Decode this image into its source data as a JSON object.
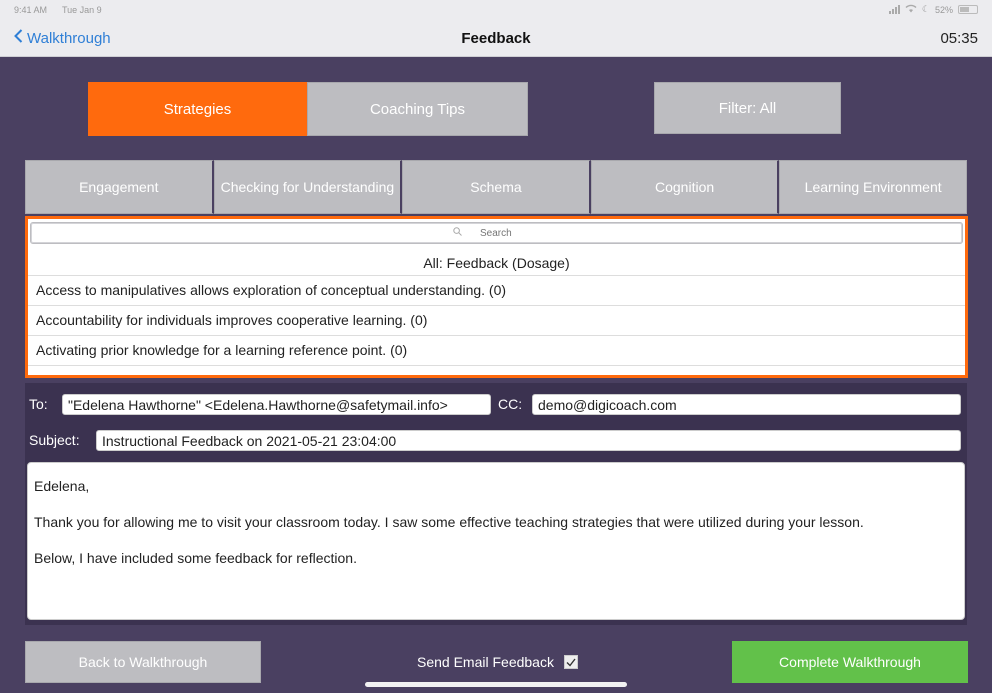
{
  "status_bar": {
    "time": "9:41 AM",
    "date": "Tue Jan 9",
    "battery": "52%"
  },
  "nav": {
    "back_label": "Walkthrough",
    "title": "Feedback",
    "timer": "05:35"
  },
  "tabs": [
    {
      "label": "Strategies",
      "selected": true
    },
    {
      "label": "Coaching Tips",
      "selected": false
    }
  ],
  "filter": {
    "label": "Filter: All"
  },
  "categories": [
    "Engagement",
    "Checking for Understanding",
    "Schema",
    "Cognition",
    "Learning Environment"
  ],
  "list": {
    "search_placeholder": "Search",
    "header": "All: Feedback (Dosage)",
    "items": [
      "Access to manipulatives allows exploration of conceptual understanding. (0)",
      "Accountability for individuals improves cooperative learning. (0)",
      "Activating prior knowledge for a learning reference point. (0)"
    ]
  },
  "email": {
    "to_label": "To:",
    "to_value": "\"Edelena Hawthorne\" <Edelena.Hawthorne@safetymail.info>",
    "cc_label": "CC:",
    "cc_value": "demo@digicoach.com",
    "subject_label": "Subject:",
    "subject_value": "Instructional Feedback on 2021-05-21 23:04:00",
    "body": [
      "Edelena,",
      "Thank you for allowing me to visit your classroom today. I saw some effective teaching strategies that were utilized during your lesson.",
      "Below, I have included some feedback for reflection."
    ]
  },
  "footer": {
    "back_button": "Back to Walkthrough",
    "send_email_label": "Send Email Feedback",
    "send_email_checked": true,
    "complete_button": "Complete Walkthrough"
  },
  "colors": {
    "accent": "#ff6a0d",
    "complete": "#62c14a",
    "background": "#4a4061",
    "link": "#2f7fd6"
  }
}
